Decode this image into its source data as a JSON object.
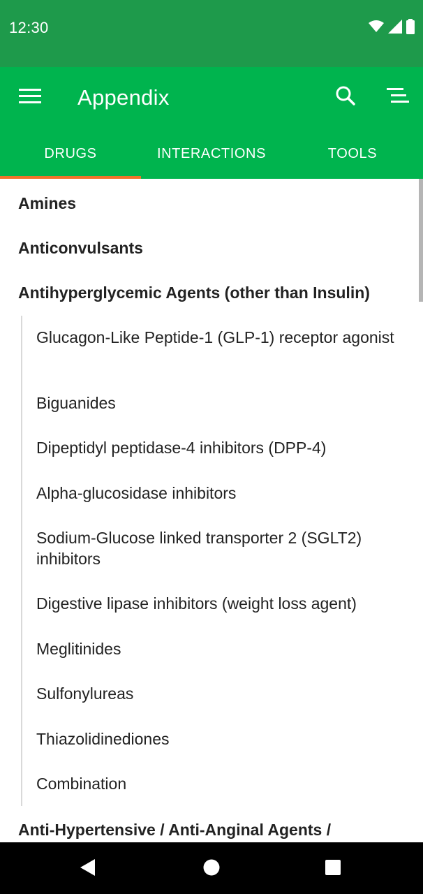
{
  "status_bar": {
    "time": "12:30",
    "icons": [
      "wifi-icon",
      "signal-icon",
      "battery-icon"
    ]
  },
  "app_bar": {
    "title": "Appendix",
    "icons": [
      "menu-icon",
      "search-icon",
      "toc-icon"
    ]
  },
  "tabs": [
    {
      "label": "DRUGS",
      "active": true
    },
    {
      "label": "INTERACTIONS",
      "active": false
    },
    {
      "label": "TOOLS",
      "active": false
    }
  ],
  "content": {
    "headings": [
      "Amines",
      "Anticonvulsants",
      "Antihyperglycemic Agents (other than Insulin)",
      "Anti-Hypertensive / Anti-Anginal Agents /"
    ],
    "sub_items": [
      "Glucagon-Like Peptide-1 (GLP-1) receptor agonist",
      "Biguanides",
      "Dipeptidyl peptidase-4 inhibitors (DPP-4)",
      "Alpha-glucosidase inhibitors",
      "Sodium-Glucose linked transporter 2 (SGLT2) inhibitors",
      "Digestive lipase inhibitors (weight loss agent)",
      "Meglitinides",
      "Sulfonylureas",
      "Thiazolidinediones",
      "Combination"
    ]
  },
  "nav_bar": {
    "icons": [
      "back-icon",
      "home-icon",
      "recents-icon"
    ]
  },
  "colors": {
    "status_bar": "#1e9a4b",
    "app_bar": "#00b44e",
    "tab_indicator": "#f0732a",
    "text": "#222222"
  }
}
